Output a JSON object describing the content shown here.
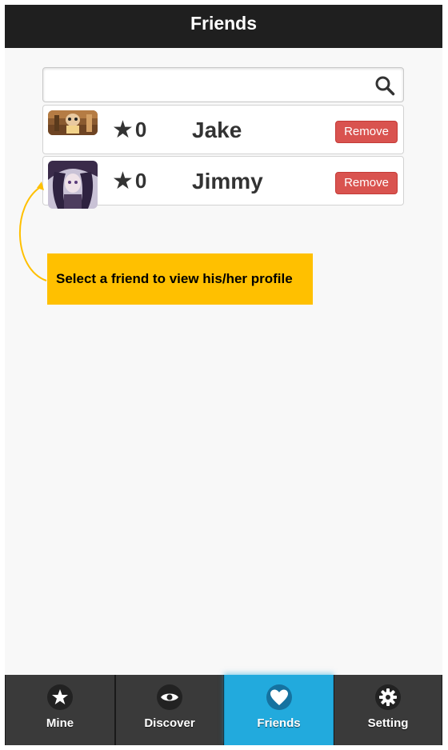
{
  "header": {
    "title": "Friends"
  },
  "search": {
    "value": "",
    "placeholder": "",
    "icon": "search-icon"
  },
  "friends": [
    {
      "stars": "0",
      "name": "Jake",
      "remove_label": "Remove"
    },
    {
      "stars": "0",
      "name": "Jimmy",
      "remove_label": "Remove"
    }
  ],
  "callout": {
    "text": "Select a friend to view his/her profile",
    "color": "#ffc000"
  },
  "tabs": [
    {
      "label": "Mine",
      "icon": "star-icon"
    },
    {
      "label": "Discover",
      "icon": "eye-icon"
    },
    {
      "label": "Friends",
      "icon": "heart-icon",
      "active": true
    },
    {
      "label": "Setting",
      "icon": "gear-icon"
    }
  ],
  "colors": {
    "header_bg": "#1f1f1f",
    "remove_button": "#d9534f",
    "active_tab": "#22aadd",
    "tabbar_bg": "#3a3a3a"
  }
}
